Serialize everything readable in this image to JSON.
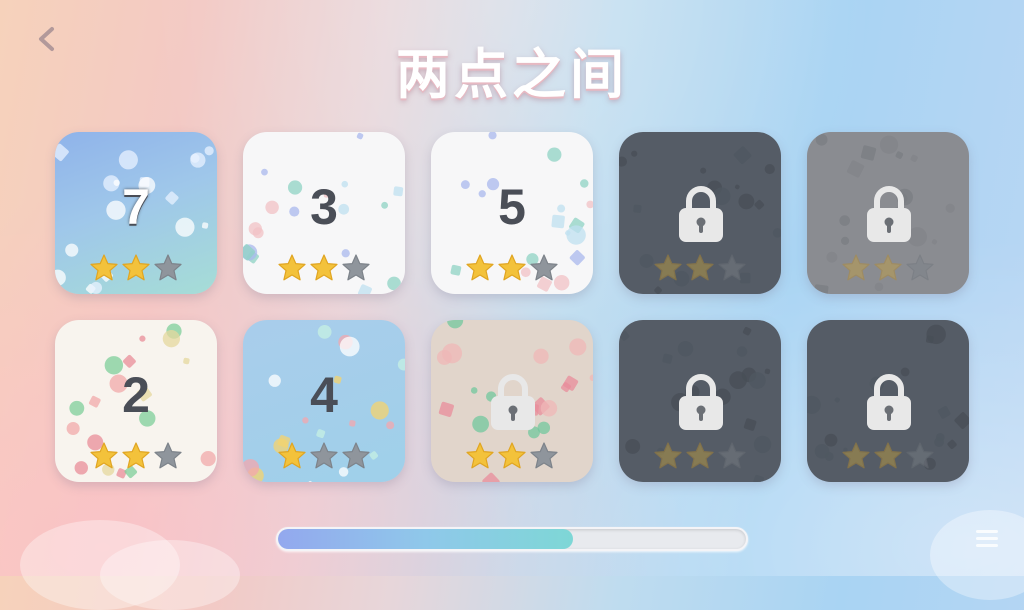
{
  "title": "两点之间",
  "levels": [
    {
      "number": "7",
      "stars": 2,
      "locked": false,
      "theme": "blue"
    },
    {
      "number": "3",
      "stars": 2,
      "locked": false,
      "theme": "white"
    },
    {
      "number": "5",
      "stars": 2,
      "locked": false,
      "theme": "white"
    },
    {
      "number": "",
      "stars": 2,
      "locked": true,
      "theme": "dark"
    },
    {
      "number": "",
      "stars": 2,
      "locked": true,
      "theme": "gray"
    },
    {
      "number": "2",
      "stars": 2,
      "locked": false,
      "theme": "cream"
    },
    {
      "number": "4",
      "stars": 1,
      "locked": false,
      "theme": "sky"
    },
    {
      "number": "",
      "stars": 2,
      "locked": true,
      "theme": "beige"
    },
    {
      "number": "",
      "stars": 2,
      "locked": true,
      "theme": "dark"
    },
    {
      "number": "",
      "stars": 2,
      "locked": true,
      "theme": "dark"
    }
  ],
  "progress": {
    "fraction": 0.63
  },
  "colors": {
    "star_gold": "#f3c23b",
    "star_empty": "#8f959c",
    "number": "#4a4e57",
    "lock": "#e8e8e8"
  },
  "icons": {
    "back": "chevron-left-icon",
    "menu": "menu-icon",
    "lock": "padlock-icon",
    "star": "star-icon"
  }
}
